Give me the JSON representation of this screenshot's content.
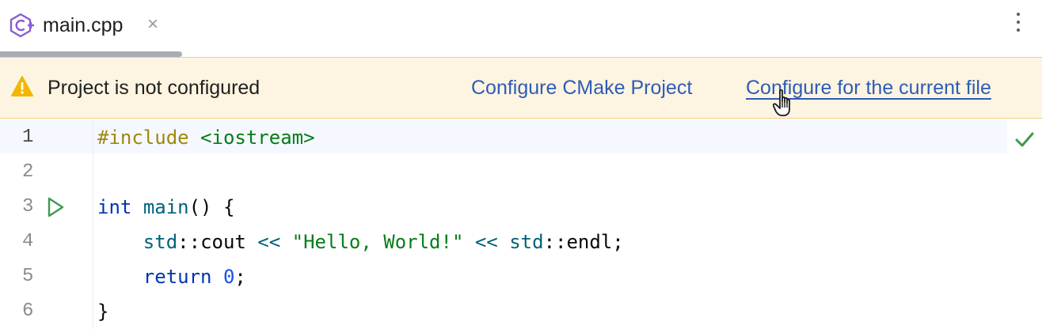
{
  "tab": {
    "title": "main.cpp",
    "close": "×",
    "icon": "cpp-file-icon"
  },
  "banner": {
    "message": "Project is not configured",
    "link_cmake": "Configure CMake Project",
    "link_current_file": "Configure for the current file",
    "icon": "warning-icon"
  },
  "editor": {
    "line_numbers": [
      "1",
      "2",
      "3",
      "4",
      "5",
      "6"
    ],
    "lines": [
      {
        "include": "#include",
        "header": " <iostream>"
      },
      {},
      {
        "kw": "int",
        "sp": " ",
        "fn": "main",
        "rest": "() {"
      },
      {
        "indent": "    ",
        "ns1": "std",
        "sep1": "::",
        "cout": "cout",
        "op1": " << ",
        "str": "\"Hello, World!\"",
        "op2": " << ",
        "ns2": "std",
        "sep2": "::",
        "endl": "endl;"
      },
      {
        "indent": "    ",
        "kw": "return",
        "sp": " ",
        "num": "0",
        "end": ";"
      },
      {
        "brace": "}"
      }
    ]
  },
  "colors": {
    "banner_bg": "#fdf5e1",
    "link": "#2f5bb7",
    "keyword": "#0033b3",
    "string": "#067d17",
    "preprocessor": "#9e880d"
  }
}
